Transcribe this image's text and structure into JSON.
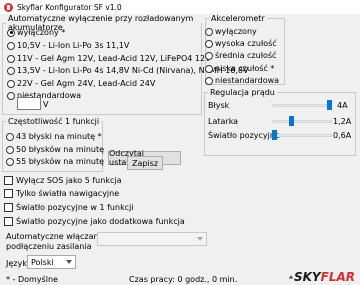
{
  "window": {
    "title": "Skyflar Konfigurator SF v1.0"
  },
  "auto_off": {
    "legend": "Automatyczne wyłączenie przy rozładowanym akumulatorze",
    "options": [
      "wyłączony *",
      "10,5V - Li-Ion Li-Po 3s 11,1V",
      "11V - Gel Agm 12V, Lead-Acid 12V, LiFePO4 12V",
      "13,5V - Li-Ion Li-Po 4s 14,8V Ni-Cd (Nirvana), Ni-MH 16,8V",
      "22V - Gel Agm 24V, Lead-Acid 24V",
      "niestandardowa"
    ],
    "selected": 0,
    "custom_value": "",
    "custom_unit": "V"
  },
  "accelerometer": {
    "legend": "Akcelerometr",
    "options": [
      "wyłączony",
      "wysoka czułość",
      "średnia czułość",
      "niska czułość *",
      "niestandardowa"
    ],
    "selected": -1
  },
  "light_reg": {
    "legend": "Regulacja prądu",
    "items": [
      {
        "label": "Błysk",
        "value": "4A",
        "fraction": 1.0
      },
      {
        "label": "Latarka",
        "value": "1,2A",
        "fraction": 0.3
      },
      {
        "label": "Światło pozycyjne",
        "value": "0,6A",
        "fraction": 0.0
      }
    ]
  },
  "flash_freq": {
    "legend": "Częstotliwość 1 funkcji",
    "options": [
      "43 błyski na minutę *",
      "50 błysków na minutę",
      "55 błysków na minutę"
    ],
    "selected": -1
  },
  "buttons": {
    "read": "Odczytaj ustawienia",
    "save": "Zapisz"
  },
  "checks": [
    "Wyłącz SOS jako 5 funkcja",
    "Tylko światła nawigacyjne",
    "Światło pozycyjne w 1 funkcji",
    "Światło pozycyjne jako dodatkowa funkcja"
  ],
  "auto_on": {
    "label_line1": "Automatyczne włączanie po",
    "label_line2": "podłączeniu zasilania",
    "value": ""
  },
  "language": {
    "label": "Język:",
    "value": "Polski"
  },
  "footer": {
    "default_note": "* - Domyślne",
    "worktime": "Czas pracy: 0 godz., 0 min."
  },
  "logo": {
    "text_a": "SKY",
    "text_b": "FLAR",
    "accent": "#d32f2f"
  }
}
